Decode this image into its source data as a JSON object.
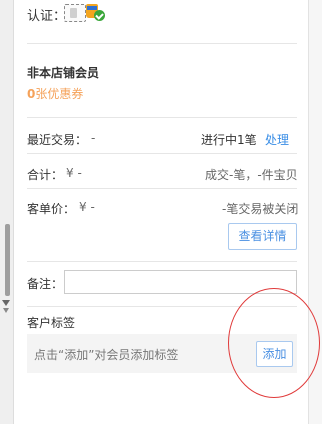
{
  "auth": {
    "label": "认证："
  },
  "member": {
    "title": "非本店铺会员",
    "coupon_count": "0",
    "coupon_suffix": "张优惠券"
  },
  "stats": {
    "recent_label": "最近交易：",
    "recent_value": "-",
    "in_progress": "进行中1笔",
    "handle_link": "处理",
    "total_label": "合计：",
    "total_value": "¥ -",
    "total_detail": "成交-笔，-件宝贝",
    "avg_label": "客单价：",
    "avg_value": "¥ -",
    "closed_text": "-笔交易被关闭",
    "detail_button": "查看详情"
  },
  "remark": {
    "label": "备注：",
    "value": ""
  },
  "tags": {
    "title": "客户标签",
    "hint": "点击“添加”对会员添加标签",
    "add_button": "添加"
  },
  "colors": {
    "accent": "#4a90e2",
    "coupon": "#f5a25a",
    "annotation": "#e03a3a"
  }
}
